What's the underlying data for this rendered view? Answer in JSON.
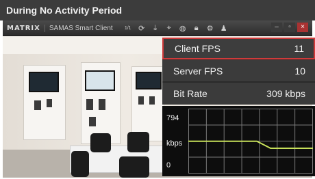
{
  "title_bar": {
    "text": "During No Activity Period"
  },
  "toolbar": {
    "logo": "MATRIX",
    "app_name": "SAMAS Smart Client",
    "icons": [
      "layout-1-1-icon",
      "refresh-icon",
      "download-icon",
      "pin-icon",
      "globe-icon",
      "lock-icon",
      "settings-icon",
      "user-icon"
    ],
    "layout_label": "1/1",
    "window_controls": [
      "minimize",
      "restore",
      "close"
    ]
  },
  "stats": [
    {
      "label": "Client FPS",
      "value": "11",
      "highlight": true
    },
    {
      "label": "Server FPS",
      "value": "10",
      "highlight": false
    },
    {
      "label": "Bit Rate",
      "value": "309 kbps",
      "highlight": false
    }
  ],
  "graph": {
    "max_label": "794",
    "unit_label": "kbps",
    "min_label": "0"
  },
  "chart_data": {
    "type": "line",
    "ylim": [
      0,
      794
    ],
    "series": [
      {
        "x": [
          0,
          0.55,
          0.66,
          1.0
        ],
        "values": [
          395,
          395,
          309,
          309
        ]
      }
    ],
    "line_color": "#c7e05a",
    "grid": true
  }
}
